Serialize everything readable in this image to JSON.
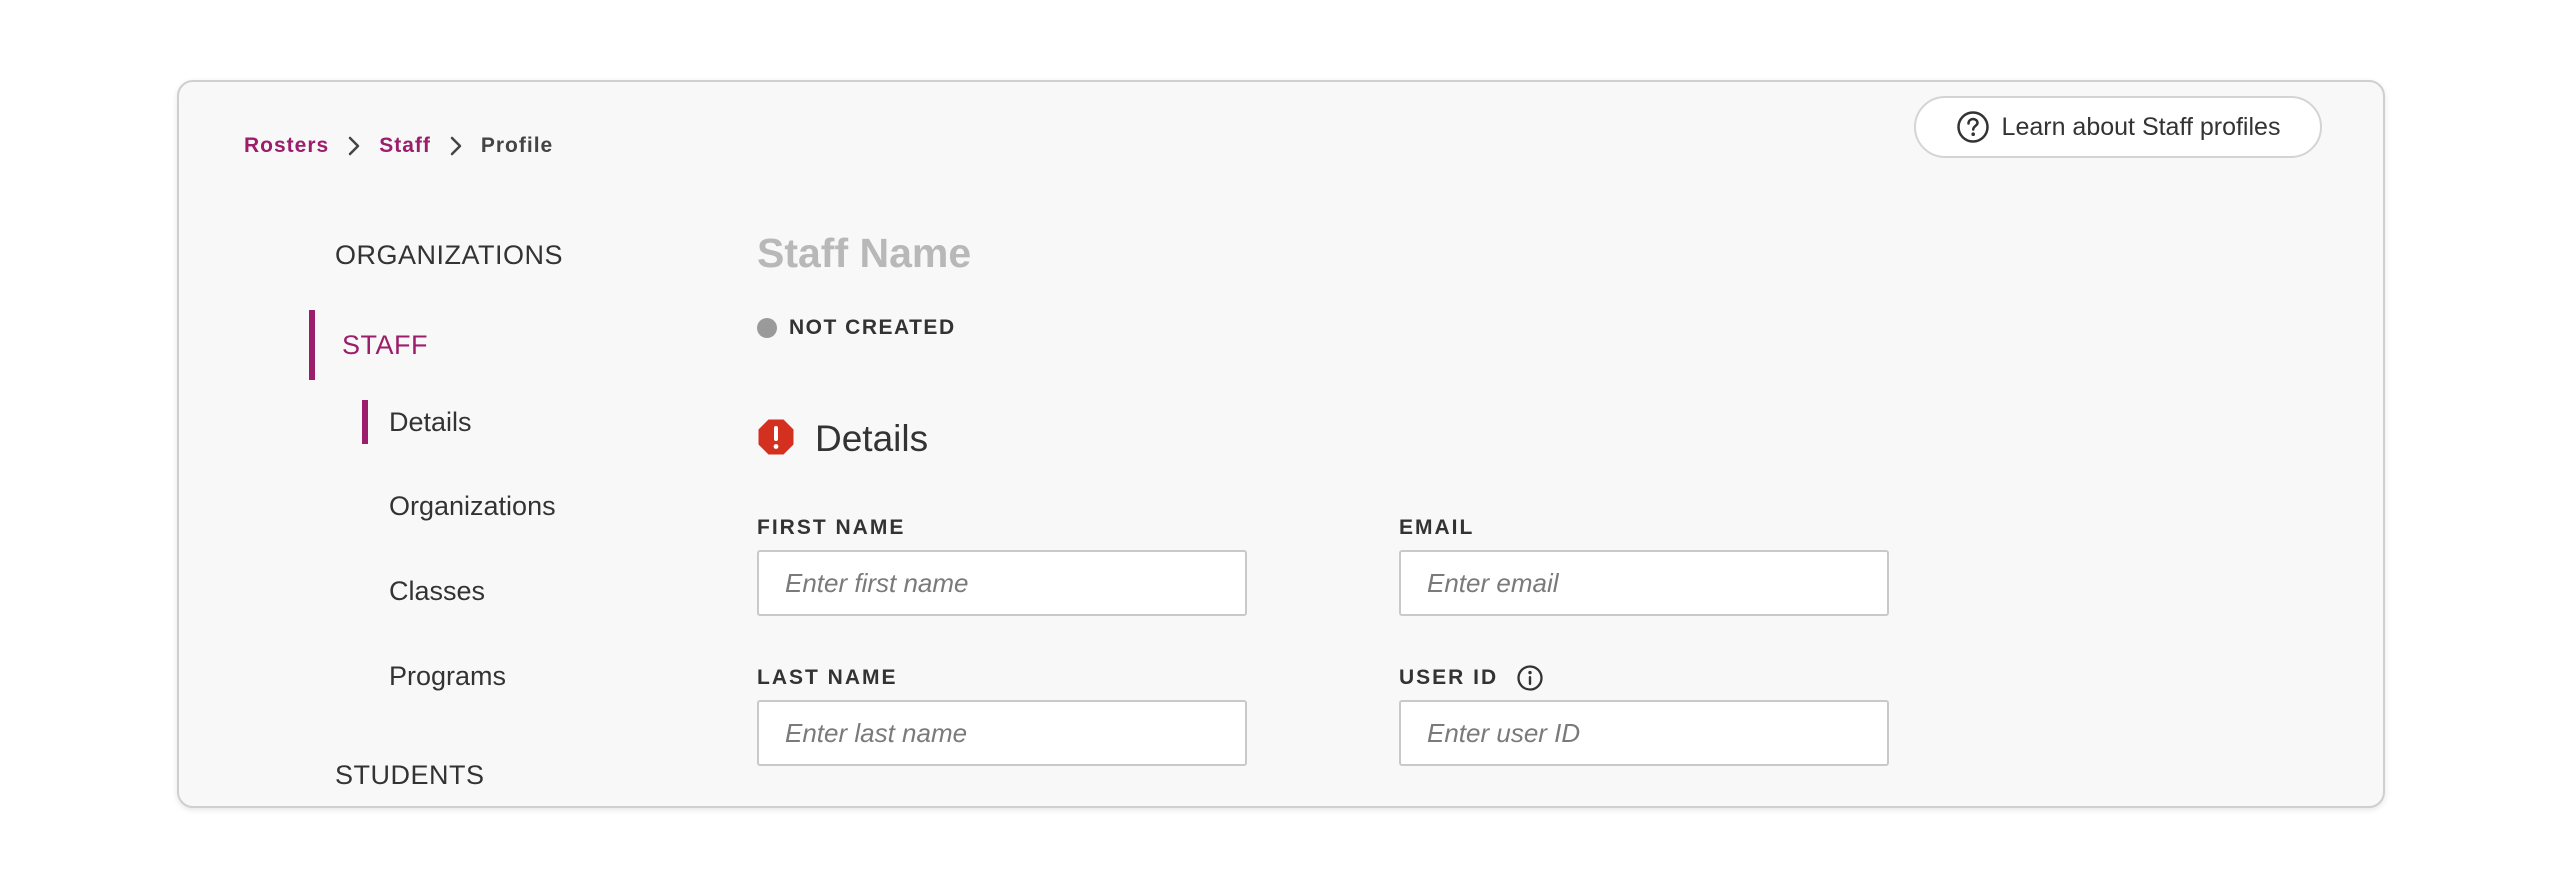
{
  "breadcrumb": {
    "items": [
      "Rosters",
      "Staff"
    ],
    "current": "Profile"
  },
  "help": {
    "label": "Learn about Staff profiles"
  },
  "nav": {
    "organizations": "ORGANIZATIONS",
    "staff": "STAFF",
    "staff_children": [
      "Details",
      "Organizations",
      "Classes",
      "Programs"
    ],
    "students": "STUDENTS"
  },
  "profile": {
    "name": "Staff Name",
    "status": "NOT CREATED"
  },
  "details": {
    "title": "Details",
    "fields": {
      "first_name": {
        "label": "FIRST NAME",
        "value": "",
        "placeholder": "Enter first name"
      },
      "email": {
        "label": "EMAIL",
        "value": "",
        "placeholder": "Enter email"
      },
      "last_name": {
        "label": "LAST NAME",
        "value": "",
        "placeholder": "Enter last name"
      },
      "user_id": {
        "label": "USER ID",
        "value": "",
        "placeholder": "Enter user ID"
      }
    }
  },
  "colors": {
    "accent": "#9b1d6b",
    "error": "#d4301f",
    "status_not_created": "#9a9a9a",
    "muted_title": "#b8b8b8"
  },
  "icons": {
    "chevron": "chevron-right-icon",
    "help": "question-circle-icon",
    "error": "error-octagon-icon",
    "info": "info-circle-icon"
  }
}
